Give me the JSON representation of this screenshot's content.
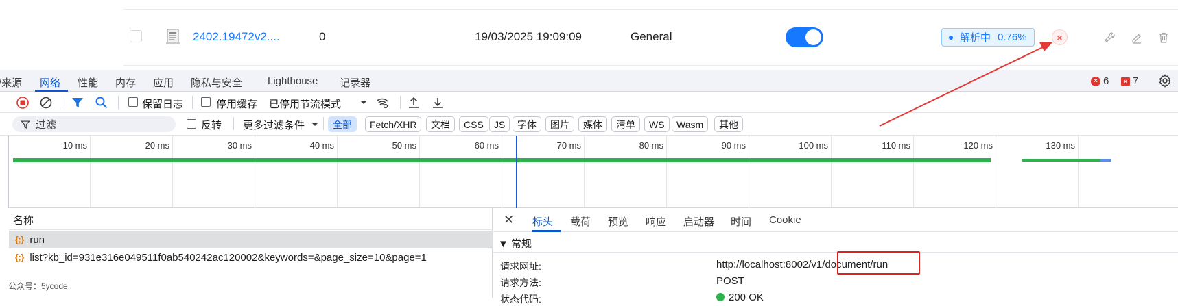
{
  "document_row": {
    "name": "2402.19472v2....",
    "chunk_count": "0",
    "upload_date": "19/03/2025 19:09:09",
    "parser": "General",
    "enabled": true,
    "status_label": "解析中",
    "status_progress": "0.76%",
    "cancel_symbol": "×"
  },
  "devtools": {
    "tabs": [
      {
        "label": "/来源"
      },
      {
        "label": "网络"
      },
      {
        "label": "性能"
      },
      {
        "label": "内存"
      },
      {
        "label": "应用"
      },
      {
        "label": "隐私与安全"
      },
      {
        "label": "Lighthouse"
      },
      {
        "label": "记录器"
      }
    ],
    "errors": "6",
    "warnings": "7",
    "error_symbol": "×",
    "warning_symbol": "×",
    "toolbar": {
      "preserve_log": "保留日志",
      "disable_cache": "停用缓存",
      "throttling": "已停用节流模式"
    },
    "filter": {
      "placeholder": "过滤",
      "invert": "反转",
      "more_filters": "更多过滤条件",
      "types": [
        "全部",
        "Fetch/XHR",
        "文档",
        "CSS",
        "JS",
        "字体",
        "图片",
        "媒体",
        "清单",
        "WS",
        "Wasm",
        "其他"
      ]
    },
    "timeline": {
      "ticks": [
        "10 ms",
        "20 ms",
        "30 ms",
        "40 ms",
        "50 ms",
        "60 ms",
        "70 ms",
        "80 ms",
        "90 ms",
        "100 ms",
        "110 ms",
        "120 ms",
        "130 ms"
      ]
    },
    "requests": {
      "header": "名称",
      "icon_text": "{;}",
      "rows": [
        {
          "name": "run"
        },
        {
          "name": "list?kb_id=931e316e049511f0ab540242ac120002&keywords=&page_size=10&page=1"
        }
      ]
    },
    "details": {
      "close": "✕",
      "tabs": [
        "标头",
        "载荷",
        "预览",
        "响应",
        "启动器",
        "时间",
        "Cookie"
      ],
      "section": "▼ 常规",
      "rows": [
        {
          "key": "请求网址:",
          "value": "http://localhost:8002/v1/document/run"
        },
        {
          "key": "请求方法:",
          "value": "POST"
        },
        {
          "key": "状态代码:",
          "value": "200 OK"
        }
      ]
    }
  },
  "watermark": "公众号：5ycode"
}
